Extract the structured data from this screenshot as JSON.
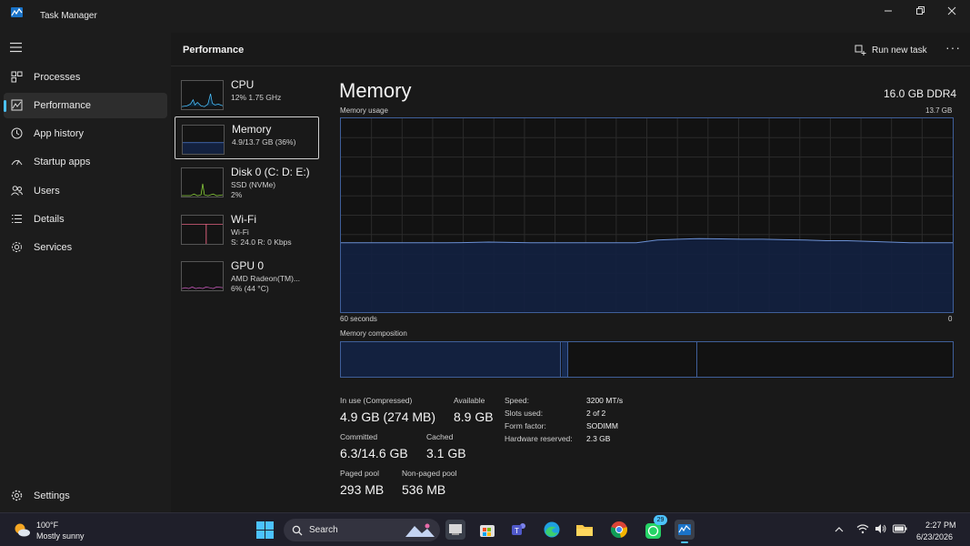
{
  "window": {
    "title": "Task Manager"
  },
  "sidebar": {
    "items": [
      {
        "label": "Processes",
        "icon": "processes-icon"
      },
      {
        "label": "Performance",
        "icon": "performance-icon",
        "active": true
      },
      {
        "label": "App history",
        "icon": "app-history-icon"
      },
      {
        "label": "Startup apps",
        "icon": "startup-apps-icon"
      },
      {
        "label": "Users",
        "icon": "users-icon"
      },
      {
        "label": "Details",
        "icon": "details-icon"
      },
      {
        "label": "Services",
        "icon": "services-icon"
      }
    ],
    "settings_label": "Settings"
  },
  "header": {
    "title": "Performance",
    "run_new_task": "Run new task"
  },
  "devices": [
    {
      "name": "CPU",
      "line1": "12%  1.75 GHz",
      "line2": "",
      "color": "#4cc2ff"
    },
    {
      "name": "Memory",
      "line1": "4.9/13.7 GB (36%)",
      "line2": "",
      "color": "#4a7bd4",
      "selected": true
    },
    {
      "name": "Disk 0 (C: D: E:)",
      "line1": "SSD (NVMe)",
      "line2": "2%",
      "color": "#8ccf3f"
    },
    {
      "name": "Wi-Fi",
      "line1": "Wi-Fi",
      "line2": "S: 24.0  R: 0 Kbps",
      "color": "#e0607e"
    },
    {
      "name": "GPU 0",
      "line1": "AMD Radeon(TM)...",
      "line2": "6%  (44 °C)",
      "color": "#c45ab8"
    }
  ],
  "memory": {
    "title": "Memory",
    "total": "16.0 GB DDR4",
    "usage_label": "Memory usage",
    "usage_max": "13.7 GB",
    "time_left": "60 seconds",
    "time_right": "0",
    "composition_label": "Memory composition",
    "stats": {
      "in_use_label": "In use (Compressed)",
      "in_use_value": "4.9 GB (274 MB)",
      "available_label": "Available",
      "available_value": "8.9 GB",
      "committed_label": "Committed",
      "committed_value": "6.3/14.6 GB",
      "cached_label": "Cached",
      "cached_value": "3.1 GB",
      "paged_label": "Paged pool",
      "paged_value": "293 MB",
      "nonpaged_label": "Non-paged pool",
      "nonpaged_value": "536 MB"
    },
    "details": [
      {
        "label": "Speed:",
        "value": "3200 MT/s"
      },
      {
        "label": "Slots used:",
        "value": "2 of 2"
      },
      {
        "label": "Form factor:",
        "value": "SODIMM"
      },
      {
        "label": "Hardware reserved:",
        "value": "2.3 GB"
      }
    ],
    "accent": "#3f5f9a",
    "fill": "#13213f"
  },
  "chart_data": {
    "type": "area",
    "title": "Memory usage",
    "x_range": [
      60,
      0
    ],
    "ylim": [
      0,
      13.7
    ],
    "unit": "GB",
    "values": [
      4.9,
      4.9,
      4.9,
      4.9,
      4.9,
      4.9,
      4.92,
      4.95,
      4.93,
      4.9,
      4.9,
      4.9,
      4.9,
      4.9,
      4.9,
      5.1,
      5.15,
      5.2,
      5.18,
      5.15,
      5.15,
      5.12,
      5.1,
      5.05,
      5.05,
      5.0,
      4.95,
      4.9,
      4.9,
      4.9
    ]
  },
  "composition": {
    "in_use_fraction": 0.36,
    "modified_fraction": 0.01,
    "standby_fraction": 0.21
  },
  "taskbar": {
    "weather_temp": "100°F",
    "weather_desc": "Mostly sunny",
    "search_label": "Search",
    "whatsapp_badge": "29",
    "time": "2:27 PM",
    "date": "6/23/2026"
  }
}
